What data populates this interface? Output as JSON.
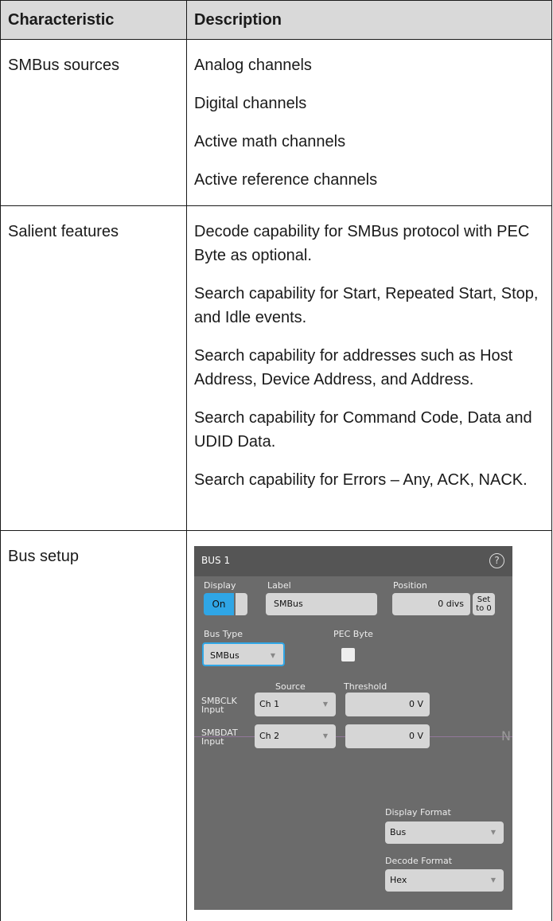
{
  "table": {
    "headers": [
      "Characteristic",
      "Description"
    ],
    "rows": [
      {
        "characteristic": "SMBus sources",
        "description": [
          "Analog channels",
          "Digital channels",
          "Active math channels",
          "Active reference channels"
        ]
      },
      {
        "characteristic": "Salient features",
        "description": [
          "Decode capability for SMBus protocol with PEC Byte as optional.",
          "Search capability for Start, Repeated Start, Stop, and Idle events.",
          "Search capability for addresses such as Host Address, Device Address, and Address.",
          "Search capability for Command Code, Data and UDID Data.",
          "Search capability for Errors – Any, ACK, NACK."
        ]
      },
      {
        "characteristic": "Bus setup"
      }
    ]
  },
  "panel": {
    "title": "BUS 1",
    "help_icon": "help-circle-icon",
    "help_glyph": "?",
    "display_label": "Display",
    "display_value": "On",
    "label_label": "Label",
    "label_value": "SMBus",
    "position_label": "Position",
    "position_value": "0 divs",
    "set_to_zero_line1": "Set",
    "set_to_zero_line2": "to 0",
    "bus_type_label": "Bus Type",
    "bus_type_value": "SMBus",
    "pec_byte_label": "PEC Byte",
    "pec_byte_checked": false,
    "source_label": "Source",
    "threshold_label": "Threshold",
    "clk_label_line1": "SMBCLK",
    "clk_label_line2": "Input",
    "clk_source": "Ch 1",
    "clk_threshold": "0 V",
    "dat_label_line1": "SMBDAT",
    "dat_label_line2": "Input",
    "dat_source": "Ch 2",
    "dat_threshold": "0 V",
    "display_format_label": "Display Format",
    "display_format_value": "Bus",
    "decode_format_label": "Decode Format",
    "decode_format_value": "Hex",
    "accent_color": "#2fa6e6"
  }
}
